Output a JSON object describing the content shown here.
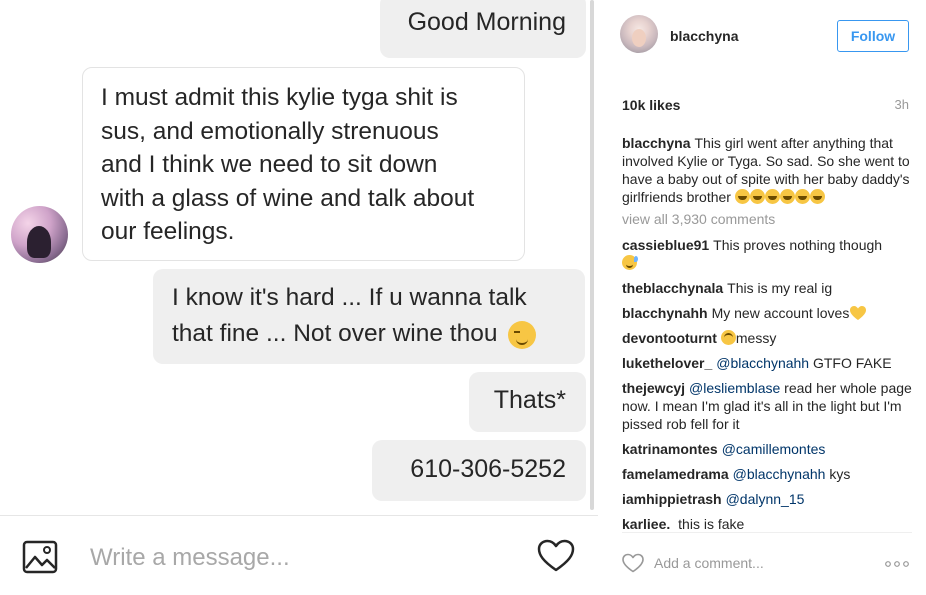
{
  "chat": {
    "messages": [
      {
        "direction": "outgoing",
        "text": "Good Morning"
      },
      {
        "direction": "incoming",
        "lines": [
          "I must admit this kylie tyga shit is",
          "sus, and emotionally strenuous",
          "and I think we need to sit down",
          "with a glass of wine and talk about",
          "our feelings."
        ]
      },
      {
        "direction": "outgoing",
        "lines": [
          "I know it's hard ... If u wanna talk",
          "that fine ... Not over wine thou"
        ],
        "emoji": "winking-face"
      },
      {
        "direction": "outgoing",
        "text": "Thats*"
      },
      {
        "direction": "outgoing",
        "text": "610-306-5252"
      }
    ],
    "message_placeholder": "Write a message...",
    "icons": {
      "image": "image-icon",
      "like": "heart-icon"
    }
  },
  "post": {
    "username": "blacchyna",
    "follow_label": "Follow",
    "likes": "10k likes",
    "time": "3h",
    "caption": {
      "username": "blacchyna",
      "text": "This girl went after anything that involved Kylie or Tyga. So sad. So she went to have a baby out of spite with her baby daddy's girlfriends brother",
      "emoji": "laughing-crying-face x6"
    },
    "view_all": "view all 3,930 comments",
    "comments": [
      {
        "username": "cassieblue91",
        "text": "This proves nothing though",
        "emoji": "grinning-sweat-face"
      },
      {
        "username": "theblacchynala",
        "text": "This is my real ig"
      },
      {
        "username": "blacchynahh",
        "text": "My new account loves",
        "emoji": "yellow-heart"
      },
      {
        "username": "devontooturnt",
        "text": "messy",
        "emoji": "eye-roll-face"
      },
      {
        "username": "lukethelover_",
        "mention": "@blacchynahh",
        "text": "GTFO FAKE"
      },
      {
        "username": "thejewcyj",
        "mention": "@lesliemblase",
        "text": "read her whole page now. I mean I'm glad it's all in the light but I'm pissed rob fell for it"
      },
      {
        "username": "katrinamontes",
        "mention": "@camillemontes",
        "text": ""
      },
      {
        "username": "famelamedrama",
        "mention": "@blacchynahh",
        "text": "kys"
      },
      {
        "username": "iamhippietrash",
        "mention": "@dalynn_15",
        "text": ""
      },
      {
        "username": "karliee.",
        "text": "this is fake"
      }
    ],
    "comment_placeholder": "Add a comment...",
    "colors": {
      "accent": "#3897f0",
      "mention": "#003569",
      "muted": "#999999"
    }
  }
}
